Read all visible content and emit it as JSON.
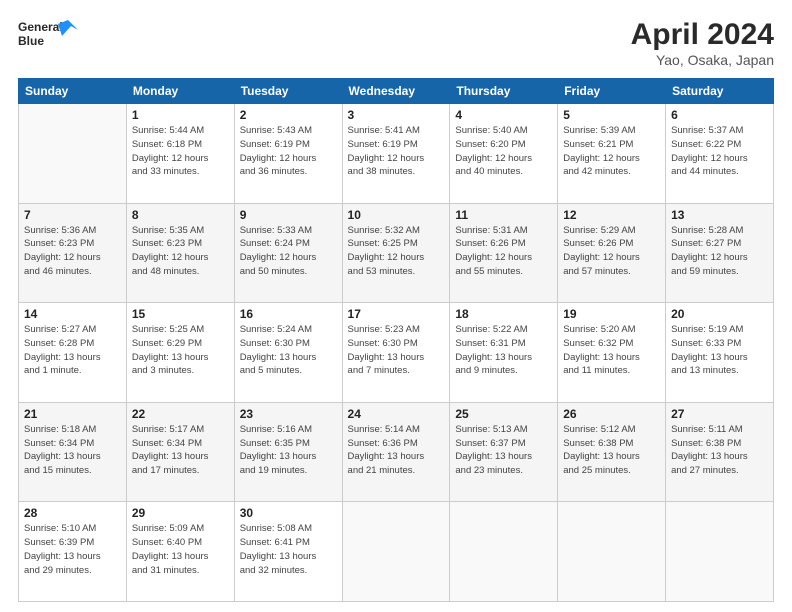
{
  "header": {
    "logo_line1": "General",
    "logo_line2": "Blue",
    "title": "April 2024",
    "subtitle": "Yao, Osaka, Japan"
  },
  "weekdays": [
    "Sunday",
    "Monday",
    "Tuesday",
    "Wednesday",
    "Thursday",
    "Friday",
    "Saturday"
  ],
  "weeks": [
    [
      {
        "day": "",
        "info": ""
      },
      {
        "day": "1",
        "info": "Sunrise: 5:44 AM\nSunset: 6:18 PM\nDaylight: 12 hours\nand 33 minutes."
      },
      {
        "day": "2",
        "info": "Sunrise: 5:43 AM\nSunset: 6:19 PM\nDaylight: 12 hours\nand 36 minutes."
      },
      {
        "day": "3",
        "info": "Sunrise: 5:41 AM\nSunset: 6:19 PM\nDaylight: 12 hours\nand 38 minutes."
      },
      {
        "day": "4",
        "info": "Sunrise: 5:40 AM\nSunset: 6:20 PM\nDaylight: 12 hours\nand 40 minutes."
      },
      {
        "day": "5",
        "info": "Sunrise: 5:39 AM\nSunset: 6:21 PM\nDaylight: 12 hours\nand 42 minutes."
      },
      {
        "day": "6",
        "info": "Sunrise: 5:37 AM\nSunset: 6:22 PM\nDaylight: 12 hours\nand 44 minutes."
      }
    ],
    [
      {
        "day": "7",
        "info": "Sunrise: 5:36 AM\nSunset: 6:23 PM\nDaylight: 12 hours\nand 46 minutes."
      },
      {
        "day": "8",
        "info": "Sunrise: 5:35 AM\nSunset: 6:23 PM\nDaylight: 12 hours\nand 48 minutes."
      },
      {
        "day": "9",
        "info": "Sunrise: 5:33 AM\nSunset: 6:24 PM\nDaylight: 12 hours\nand 50 minutes."
      },
      {
        "day": "10",
        "info": "Sunrise: 5:32 AM\nSunset: 6:25 PM\nDaylight: 12 hours\nand 53 minutes."
      },
      {
        "day": "11",
        "info": "Sunrise: 5:31 AM\nSunset: 6:26 PM\nDaylight: 12 hours\nand 55 minutes."
      },
      {
        "day": "12",
        "info": "Sunrise: 5:29 AM\nSunset: 6:26 PM\nDaylight: 12 hours\nand 57 minutes."
      },
      {
        "day": "13",
        "info": "Sunrise: 5:28 AM\nSunset: 6:27 PM\nDaylight: 12 hours\nand 59 minutes."
      }
    ],
    [
      {
        "day": "14",
        "info": "Sunrise: 5:27 AM\nSunset: 6:28 PM\nDaylight: 13 hours\nand 1 minute."
      },
      {
        "day": "15",
        "info": "Sunrise: 5:25 AM\nSunset: 6:29 PM\nDaylight: 13 hours\nand 3 minutes."
      },
      {
        "day": "16",
        "info": "Sunrise: 5:24 AM\nSunset: 6:30 PM\nDaylight: 13 hours\nand 5 minutes."
      },
      {
        "day": "17",
        "info": "Sunrise: 5:23 AM\nSunset: 6:30 PM\nDaylight: 13 hours\nand 7 minutes."
      },
      {
        "day": "18",
        "info": "Sunrise: 5:22 AM\nSunset: 6:31 PM\nDaylight: 13 hours\nand 9 minutes."
      },
      {
        "day": "19",
        "info": "Sunrise: 5:20 AM\nSunset: 6:32 PM\nDaylight: 13 hours\nand 11 minutes."
      },
      {
        "day": "20",
        "info": "Sunrise: 5:19 AM\nSunset: 6:33 PM\nDaylight: 13 hours\nand 13 minutes."
      }
    ],
    [
      {
        "day": "21",
        "info": "Sunrise: 5:18 AM\nSunset: 6:34 PM\nDaylight: 13 hours\nand 15 minutes."
      },
      {
        "day": "22",
        "info": "Sunrise: 5:17 AM\nSunset: 6:34 PM\nDaylight: 13 hours\nand 17 minutes."
      },
      {
        "day": "23",
        "info": "Sunrise: 5:16 AM\nSunset: 6:35 PM\nDaylight: 13 hours\nand 19 minutes."
      },
      {
        "day": "24",
        "info": "Sunrise: 5:14 AM\nSunset: 6:36 PM\nDaylight: 13 hours\nand 21 minutes."
      },
      {
        "day": "25",
        "info": "Sunrise: 5:13 AM\nSunset: 6:37 PM\nDaylight: 13 hours\nand 23 minutes."
      },
      {
        "day": "26",
        "info": "Sunrise: 5:12 AM\nSunset: 6:38 PM\nDaylight: 13 hours\nand 25 minutes."
      },
      {
        "day": "27",
        "info": "Sunrise: 5:11 AM\nSunset: 6:38 PM\nDaylight: 13 hours\nand 27 minutes."
      }
    ],
    [
      {
        "day": "28",
        "info": "Sunrise: 5:10 AM\nSunset: 6:39 PM\nDaylight: 13 hours\nand 29 minutes."
      },
      {
        "day": "29",
        "info": "Sunrise: 5:09 AM\nSunset: 6:40 PM\nDaylight: 13 hours\nand 31 minutes."
      },
      {
        "day": "30",
        "info": "Sunrise: 5:08 AM\nSunset: 6:41 PM\nDaylight: 13 hours\nand 32 minutes."
      },
      {
        "day": "",
        "info": ""
      },
      {
        "day": "",
        "info": ""
      },
      {
        "day": "",
        "info": ""
      },
      {
        "day": "",
        "info": ""
      }
    ]
  ]
}
